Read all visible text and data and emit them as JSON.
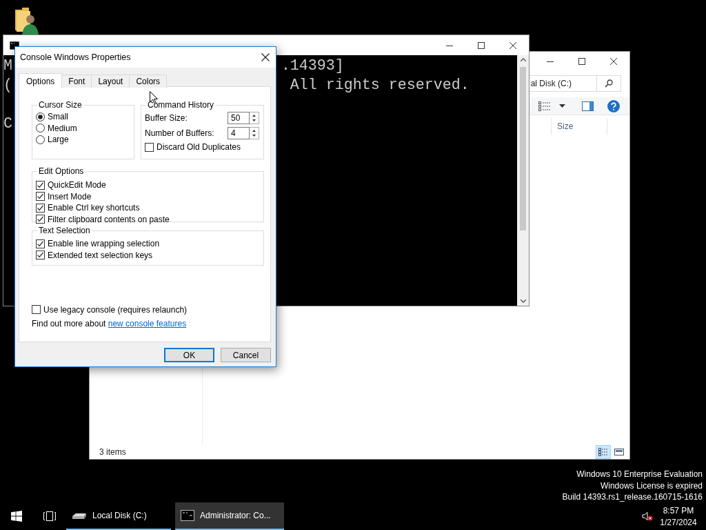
{
  "explorer": {
    "address": "al Disk (C:)",
    "columns": [
      "Size"
    ],
    "status": "3 items",
    "view_buttons": [
      {
        "kind": "details",
        "selected": true
      },
      {
        "kind": "tiles",
        "selected": false
      }
    ]
  },
  "console": {
    "lines": [
      {
        "start": "M",
        "end": ".14393]"
      },
      {
        "start": "(",
        "end": "All rights reserved."
      },
      {
        "start": "C"
      }
    ]
  },
  "dialog": {
    "title": "Console Windows Properties",
    "tabs": [
      {
        "label": "Options",
        "selected": true
      },
      {
        "label": "Font",
        "selected": false
      },
      {
        "label": "Layout",
        "selected": false
      },
      {
        "label": "Colors",
        "selected": false
      }
    ],
    "cursor_size": {
      "title": "Cursor Size",
      "options": [
        {
          "label": "Small",
          "selected": true
        },
        {
          "label": "Medium",
          "selected": false
        },
        {
          "label": "Large",
          "selected": false
        }
      ]
    },
    "command_history": {
      "title": "Command History",
      "fields": [
        {
          "label": "Buffer Size:",
          "value": "50"
        },
        {
          "label": "Number of Buffers:",
          "value": "4"
        }
      ],
      "checkboxes": [
        {
          "label": "Discard Old Duplicates",
          "checked": false
        }
      ]
    },
    "edit_options": {
      "title": "Edit Options",
      "checkboxes": [
        {
          "label": "QuickEdit Mode",
          "checked": true
        },
        {
          "label": "Insert Mode",
          "checked": true
        },
        {
          "label": "Enable Ctrl key shortcuts",
          "checked": true
        },
        {
          "label": "Filter clipboard contents on paste",
          "checked": true
        }
      ]
    },
    "text_selection": {
      "title": "Text Selection",
      "checkboxes": [
        {
          "label": "Enable line wrapping selection",
          "checked": true
        },
        {
          "label": "Extended text selection keys",
          "checked": true
        }
      ]
    },
    "legacy": {
      "label": "Use legacy console (requires relaunch)",
      "checked": false
    },
    "more": {
      "text": "Find out more about",
      "link": "new console features"
    },
    "buttons": [
      {
        "label": "OK",
        "default": true
      },
      {
        "label": "Cancel",
        "default": false
      }
    ]
  },
  "desktop_notice": [
    "Windows 10 Enterprise Evaluation",
    "Windows License is expired",
    "Build 14393.rs1_release.160715-1616"
  ],
  "taskbar": {
    "items": [
      {
        "label": "Local Disk (C:)",
        "kind": "drive",
        "selected": false
      },
      {
        "label": "Administrator: Co...",
        "kind": "console",
        "selected": true
      }
    ],
    "clock": {
      "time": "8:57 PM",
      "date": "1/27/2024"
    },
    "volume_muted": true
  }
}
